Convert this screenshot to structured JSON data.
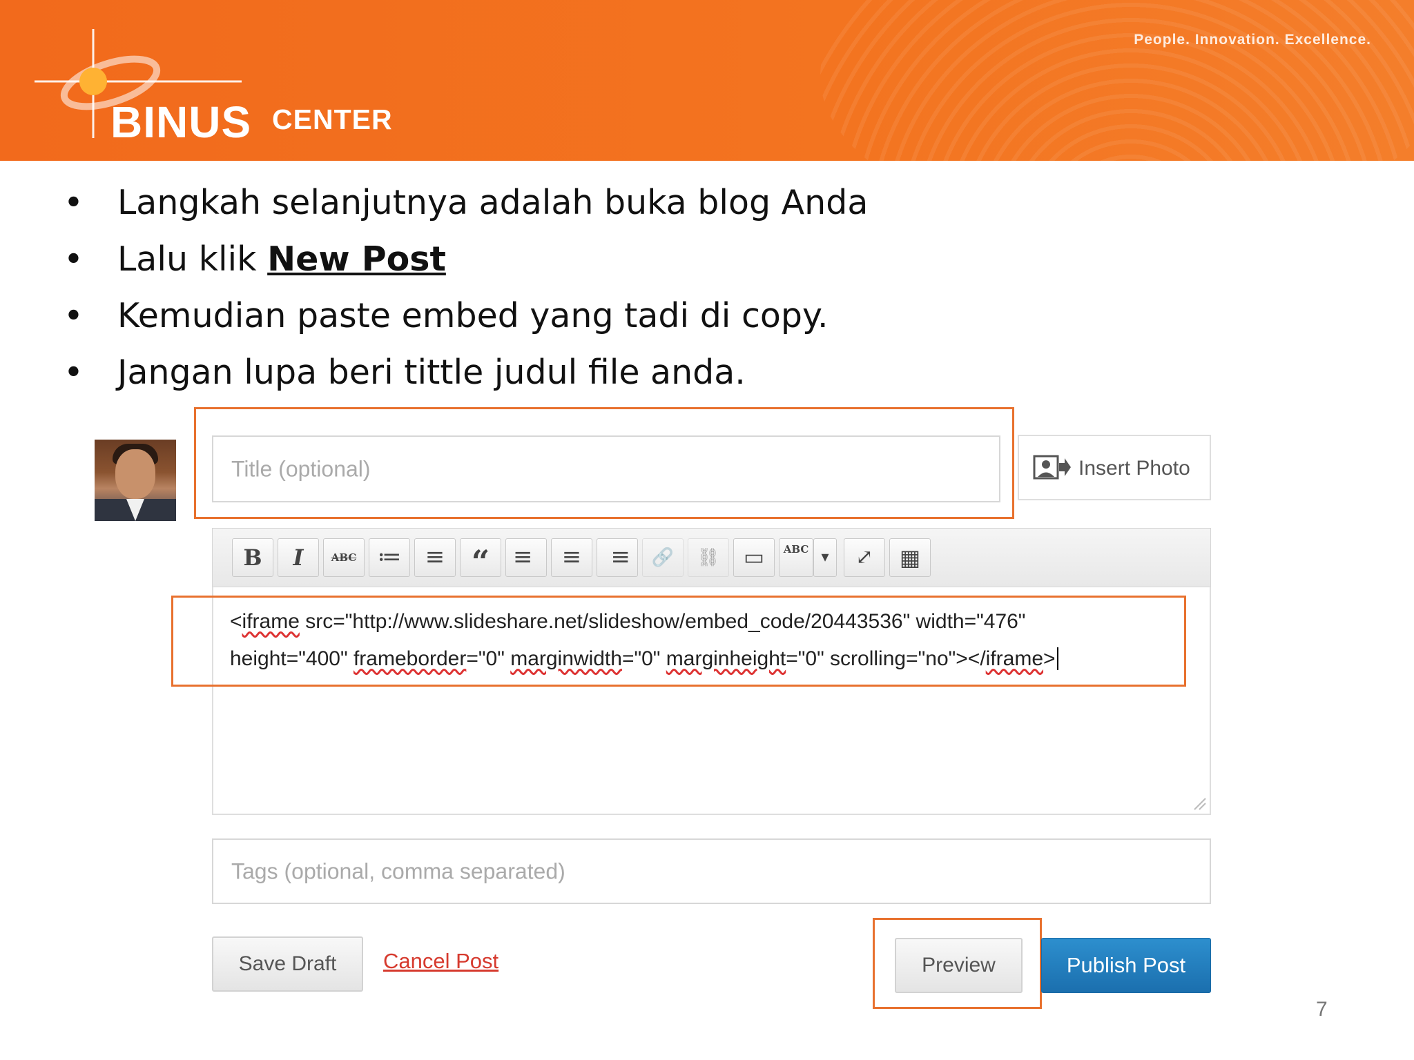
{
  "header": {
    "logo_word": "BINUS",
    "logo_sub": "CENTER",
    "tagline": "People. Innovation. Excellence.",
    "bg_color": "#f37420"
  },
  "bullets": [
    {
      "marker": "•",
      "text": "Langkah selanjutnya adalah buka blog Anda"
    },
    {
      "marker": "•",
      "prefix": "Lalu klik ",
      "strong": "New Post"
    },
    {
      "marker": "•",
      "text": "Kemudian paste embed yang tadi di copy."
    },
    {
      "marker": "•",
      "text": "Jangan lupa beri tittle judul file anda."
    }
  ],
  "editor": {
    "title_placeholder": "Title (optional)",
    "insert_photo_label": "Insert Photo",
    "toolbar": [
      {
        "icon": "bold-icon",
        "glyph": "B"
      },
      {
        "icon": "italic-icon",
        "glyph": "I"
      },
      {
        "icon": "strikethrough-icon",
        "glyph": "ABC"
      },
      {
        "icon": "bulleted-list-icon",
        "glyph": "≔"
      },
      {
        "icon": "numbered-list-icon",
        "glyph": "≡"
      },
      {
        "icon": "blockquote-icon",
        "glyph": "“"
      },
      {
        "icon": "align-left-icon",
        "glyph": "≡"
      },
      {
        "icon": "align-center-icon",
        "glyph": "≡"
      },
      {
        "icon": "align-right-icon",
        "glyph": "≡"
      },
      {
        "icon": "link-icon",
        "glyph": "🔗"
      },
      {
        "icon": "unlink-icon",
        "glyph": "⛓"
      },
      {
        "icon": "more-tag-icon",
        "glyph": "▭"
      },
      {
        "icon": "spellcheck-icon",
        "glyph": "ABC"
      },
      {
        "icon": "dropdown-caret-icon",
        "glyph": "▾"
      },
      {
        "icon": "fullscreen-icon",
        "glyph": "⤢"
      },
      {
        "icon": "kitchen-sink-icon",
        "glyph": "▦"
      }
    ],
    "content_line1": {
      "p1": "<",
      "w1": "iframe",
      "p2": " src=\"http://www.slideshare.net/slideshow/embed_code/20443536\" width=\"476\""
    },
    "content_line2": {
      "p1": "height=\"400\" ",
      "w1": "frameborder",
      "p2": "=\"0\" ",
      "w2": "marginwidth",
      "p3": "=\"0\" ",
      "w3": "marginheight",
      "p4": "=\"0\" scrolling=\"no\"></",
      "w4": "iframe",
      "p5": ">"
    },
    "tags_placeholder": "Tags (optional, comma separated)",
    "save_draft_label": "Save Draft",
    "cancel_post_label": "Cancel Post",
    "preview_label": "Preview",
    "publish_label": "Publish Post",
    "highlight_color": "#e8712e"
  },
  "page_number": "7"
}
